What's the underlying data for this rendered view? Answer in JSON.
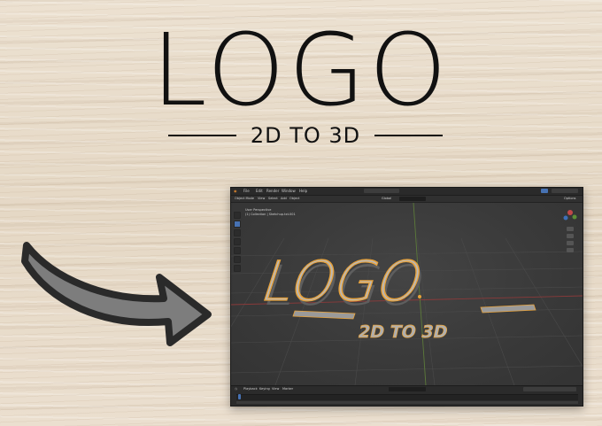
{
  "hero": {
    "title": "LOGO",
    "subtitle": "2D TO 3D"
  },
  "blender_screenshot": {
    "topbar_menus": [
      "File",
      "Edit",
      "Render",
      "Window",
      "Help"
    ],
    "header_items": [
      "Global",
      "Options"
    ],
    "viewport_overlay_line1": "User Perspective",
    "viewport_overlay_line2": "(1) Collection | Sketchup.txt.001",
    "toolbar_items": [
      "Object Mode",
      "View",
      "Select",
      "Add",
      "Object"
    ],
    "timeline_items": [
      "Playback",
      "Keying",
      "View",
      "Marker"
    ],
    "scene_text_line1": "LOGO",
    "scene_text_line2": "2D TO 3D",
    "colors": {
      "logo_fill": "#b9b9b9",
      "logo_outline": "#e8a23a",
      "viewport_bg": "#3b3b3b",
      "grid_line": "#4a4a4a",
      "axis_red": "#8b3a3a",
      "axis_green": "#5c7a3a",
      "accent_blue": "#4772b3"
    }
  },
  "arrow": {
    "icon": "curved-arrow-right-icon",
    "fill": "#7d7d7d",
    "stroke": "#2a2a2a"
  }
}
